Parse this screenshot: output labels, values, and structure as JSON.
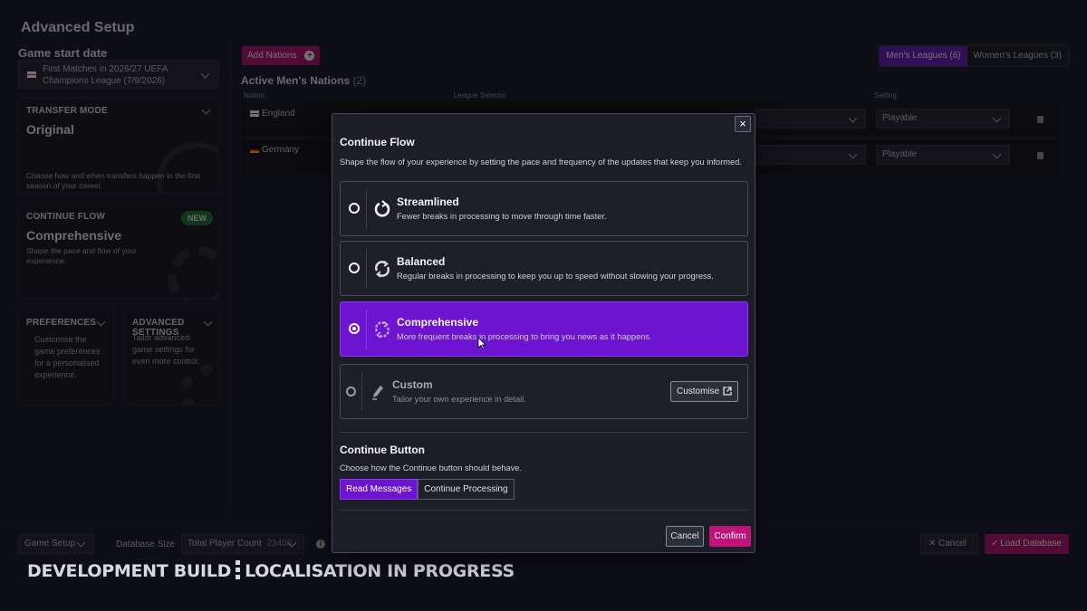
{
  "page": {
    "title": "Advanced Setup"
  },
  "sidebar": {
    "start_date_label": "Game start date",
    "start_date_value": "First Matches in 2026/27 UEFA Champions League (7/9/2026)",
    "transfer": {
      "title": "TRANSFER MODE",
      "value": "Original",
      "desc": "Choose how and when transfers happen in the first season of your career."
    },
    "continue_flow": {
      "title": "CONTINUE FLOW",
      "value": "Comprehensive",
      "badge": "NEW",
      "desc": "Shape the pace and flow of your experience."
    },
    "preferences": {
      "title": "PREFERENCES",
      "desc": "Customise the game preferences for a personalised experience."
    },
    "advanced": {
      "title": "ADVANCED SETTINGS",
      "desc": "Tailor advanced game settings for even more control."
    }
  },
  "main": {
    "add_nations": "Add Nations",
    "mens_leagues": "Men's Leagues (6)",
    "womens_leagues": "Women's Leagues (3)",
    "active_title": "Active Men's Nations",
    "active_count": "(2)",
    "columns": {
      "nation": "Nation",
      "league": "League Selector",
      "setting": "Setting"
    },
    "nations": [
      {
        "name": "England",
        "setting": "Playable"
      },
      {
        "name": "Germany",
        "setting": "Playable"
      }
    ]
  },
  "footer": {
    "game_setup": "Game Setup",
    "db_size_label": "Database Size",
    "player_count_label": "Total Player Count",
    "player_count_value": "23400",
    "cancel": "Cancel",
    "load": "Load Database"
  },
  "banner": {
    "left": "DEVELOPMENT BUILD",
    "right": "LOCALISATION IN PROGRESS"
  },
  "modal": {
    "close": "×",
    "title": "Continue Flow",
    "subtitle": "Shape the flow of your experience by setting the pace and frequency of the updates that keep you informed.",
    "options": [
      {
        "label": "Streamlined",
        "desc": "Fewer breaks in processing to move through time faster.",
        "icon": "power-cycle-icon"
      },
      {
        "label": "Balanced",
        "desc": "Regular breaks in processing to keep you up to speed without slowing your progress.",
        "icon": "refresh-icon"
      },
      {
        "label": "Comprehensive",
        "desc": "More frequent breaks in processing to bring you news as it happens.",
        "icon": "refresh-dense-icon"
      },
      {
        "label": "Custom",
        "desc": "Tailor your own experience in detail.",
        "icon": "pencil-icon"
      }
    ],
    "selected_option": "Comprehensive",
    "customise": "Customise",
    "button_section_title": "Continue Button",
    "button_section_desc": "Choose how the Continue button should behave.",
    "button_modes": [
      "Read Messages",
      "Continue Processing"
    ],
    "button_mode_selected": "Read Messages",
    "cancel": "Cancel",
    "confirm": "Confirm"
  },
  "colors": {
    "accent_purple": "#6c14d0",
    "accent_pink": "#c0137a",
    "background": "#0e0e16"
  }
}
